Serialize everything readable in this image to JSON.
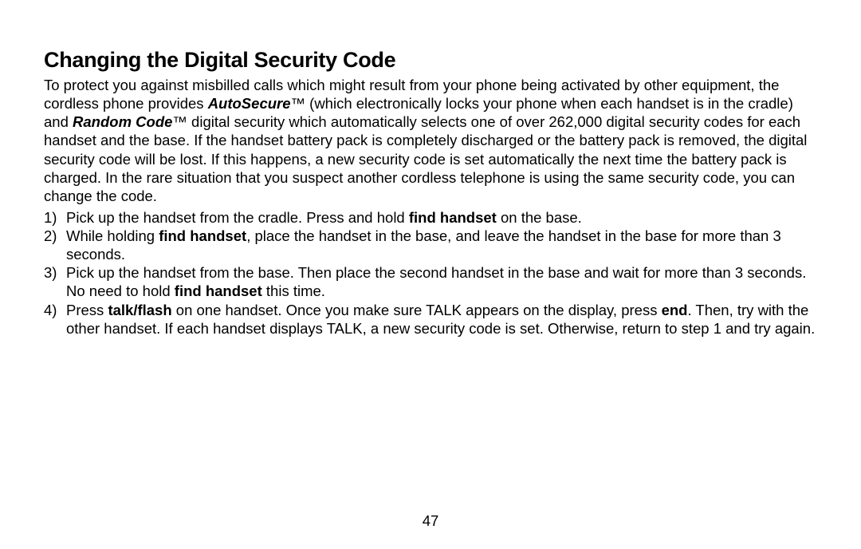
{
  "title": "Changing the Digital Security Code",
  "intro": {
    "t1": "To protect you against misbilled calls which might result from your phone being activated by other equipment, the cordless phone provides ",
    "feature1": "AutoSecure",
    "tm1": "™",
    "t2": " (which electronically locks your phone when each handset is in the cradle) and ",
    "feature2": "Random Code",
    "tm2": "™",
    "t3": " digital security which automatically selects one of over 262,000 digital security codes for each handset and the base. If the handset battery pack is completely discharged or the battery pack is removed, the digital security code will be lost. If this happens, a new security code is set automatically the next time the battery pack is charged. In the rare situation that you suspect another cordless telephone is using the same security code, you can change the code."
  },
  "steps": [
    {
      "num": "1)",
      "parts": [
        {
          "text": "Pick up the handset from the cradle. Press and hold "
        },
        {
          "text": "find handset",
          "bold": true
        },
        {
          "text": " on the base."
        }
      ]
    },
    {
      "num": "2)",
      "parts": [
        {
          "text": "While holding "
        },
        {
          "text": "find handset",
          "bold": true
        },
        {
          "text": ", place the handset in the base, and leave the handset in the base for more than 3 seconds."
        }
      ]
    },
    {
      "num": "3)",
      "parts": [
        {
          "text": "Pick up the handset from the base. Then place the second handset in the base and wait for more than 3 seconds. No need to hold "
        },
        {
          "text": "find handset",
          "bold": true
        },
        {
          "text": " this time."
        }
      ]
    },
    {
      "num": "4)",
      "parts": [
        {
          "text": "Press "
        },
        {
          "text": "talk/flash",
          "bold": true
        },
        {
          "text": " on one handset. Once you make sure TALK appears on the display, press "
        },
        {
          "text": "end",
          "bold": true
        },
        {
          "text": ". Then, try with the other handset. If each handset displays TALK, a new security code is set. Otherwise, return to step 1 and try again."
        }
      ]
    }
  ],
  "pageNumber": "47"
}
